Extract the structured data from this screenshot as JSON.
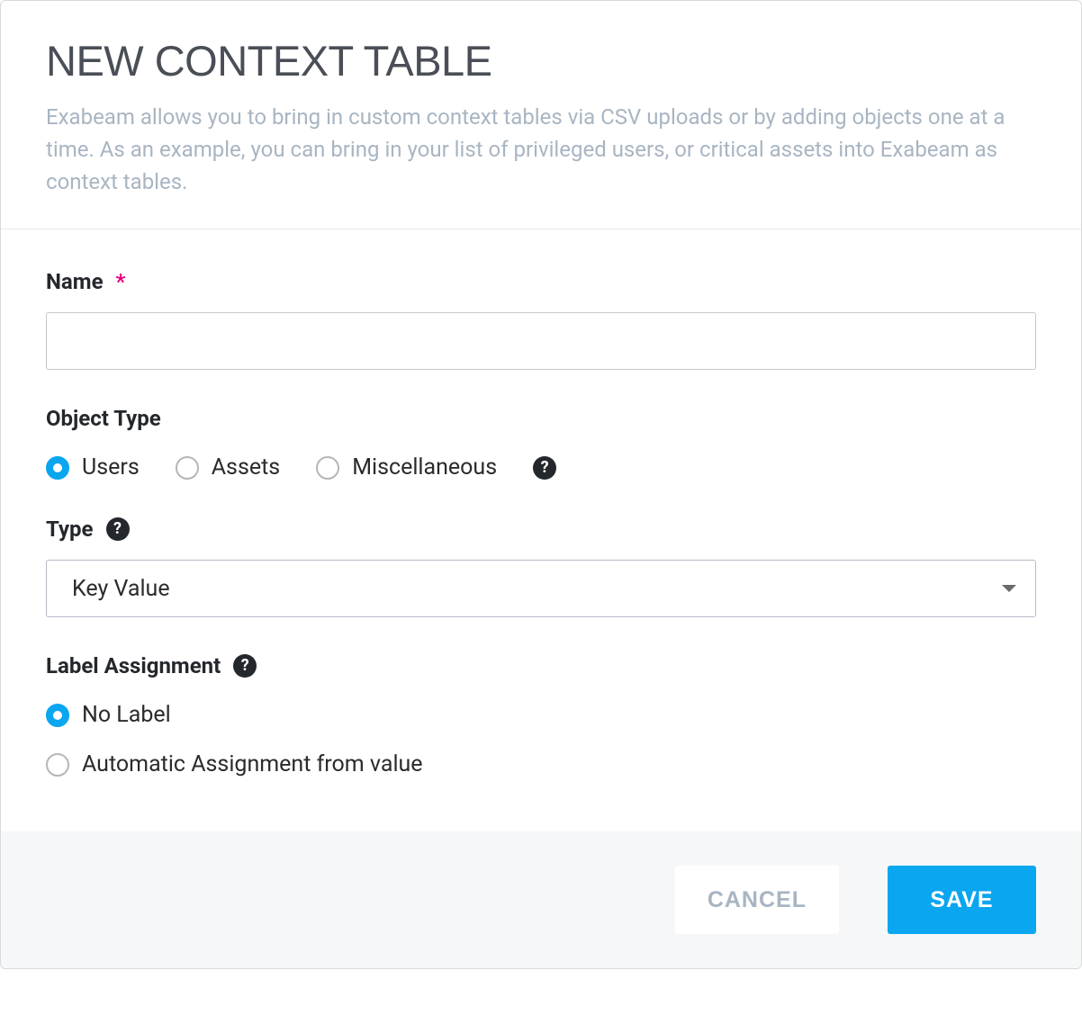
{
  "header": {
    "title": "New Context Table",
    "description": "Exabeam allows you to bring in custom context tables via CSV uploads or by adding objects one at a time. As an example, you can bring in your list of privileged users, or critical assets into Exabeam as context tables."
  },
  "form": {
    "name": {
      "label": "Name",
      "required_marker": "*",
      "value": ""
    },
    "object_type": {
      "label": "Object Type",
      "options": [
        {
          "label": "Users",
          "checked": true
        },
        {
          "label": "Assets",
          "checked": false
        },
        {
          "label": "Miscellaneous",
          "checked": false
        }
      ]
    },
    "type": {
      "label": "Type",
      "selected": "Key Value"
    },
    "label_assignment": {
      "label": "Label Assignment",
      "options": [
        {
          "label": "No Label",
          "checked": true
        },
        {
          "label": "Automatic Assignment from value",
          "checked": false
        }
      ]
    }
  },
  "footer": {
    "cancel": "Cancel",
    "save": "Save"
  }
}
